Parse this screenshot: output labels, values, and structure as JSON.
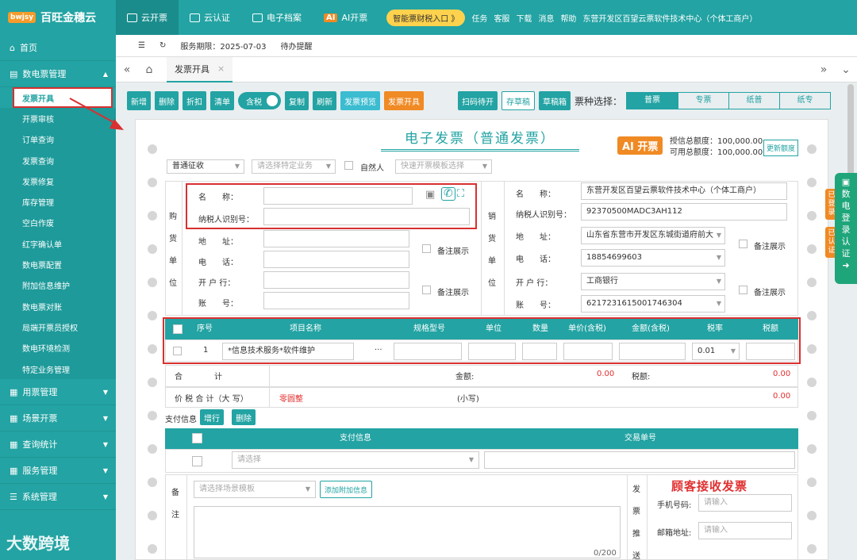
{
  "top": {
    "brand_badge": "bwjsy",
    "brand": "百旺金穗云",
    "tabs": [
      "云开票",
      "云认证",
      "电子档案",
      "AI开票"
    ],
    "ai_badge": "AI",
    "promo": "智能票财税入口 》",
    "right": [
      "任务",
      "客服",
      "下载",
      "消息",
      "帮助",
      "东营开发区百望云票软件技术中心（个体工商户）"
    ]
  },
  "sidebar": {
    "home": "首页",
    "group": "数电票管理",
    "items": [
      "发票开具",
      "开票审核",
      "订单查询",
      "发票查询",
      "发票修复",
      "库存管理",
      "空白作废",
      "红字确认单",
      "数电票配置",
      "附加信息维护",
      "数电票对账",
      "局端开票员授权",
      "数电环境检测",
      "特定业务管理"
    ],
    "groups": [
      "用票管理",
      "场景开票",
      "查询统计",
      "服务管理",
      "系统管理"
    ],
    "watermark": "大数跨境"
  },
  "subbar": {
    "period": "服务期限：2025-07-03",
    "pending": "待办提醒"
  },
  "tab": {
    "label": "发票开具"
  },
  "toolbar": {
    "buttons": [
      "新增",
      "删除",
      "折扣",
      "清单"
    ],
    "tax_incl": "含税",
    "buttons2": [
      "复制",
      "刷新",
      "发票预览",
      "发票开具"
    ],
    "right": [
      "扫码待开",
      "存草稿",
      "草稿箱"
    ],
    "type_label": "票种选择：",
    "types": [
      "普票",
      "专票",
      "纸普",
      "纸专"
    ]
  },
  "invoice": {
    "title": "电子发票（普通发票）",
    "ai_open": "AI 开票",
    "credit_total": "授信总额度：100,000.00",
    "credit_avail": "可用总额度：100,000.00",
    "update_btn": "更新额度",
    "levy": "普通征收",
    "biz_placeholder": "请选择特定业务",
    "natural_person": "自然人",
    "template_placeholder": "快速开票模板选择"
  },
  "buyer": {
    "side": "购货单位",
    "name_lbl": "名　　称：",
    "tax_lbl": "纳税人识别号：",
    "addr_lbl": "地　　址：",
    "phone_lbl": "电　　话：",
    "bank_lbl": "开 户 行：",
    "acct_lbl": "账　　号：",
    "remark1": "备注展示",
    "remark2": "备注展示"
  },
  "seller": {
    "side": "销货单位",
    "name_lbl": "名　　称：",
    "name": "东营开发区百望云票软件技术中心（个体工商户）",
    "tax_lbl": "纳税人识别号：",
    "tax": "92370500MADC3AH112",
    "addr_lbl": "地　　址：",
    "addr": "山东省东营市开发区东城街道府前大",
    "phone_lbl": "电　　话：",
    "phone": "18854699603",
    "bank_lbl": "开 户 行：",
    "bank": "工商银行",
    "acct_lbl": "账　　号：",
    "acct": "6217231615001746304",
    "remark1": "备注展示",
    "remark2": "备注展示"
  },
  "items": {
    "headers": [
      "序号",
      "项目名称",
      "规格型号",
      "单位",
      "数量",
      "单价(含税)",
      "金额(含税)",
      "税率",
      "税额"
    ],
    "row": {
      "no": "1",
      "name": "*信息技术服务*软件维护",
      "more": "···",
      "rate": "0.01"
    }
  },
  "totals": {
    "sum_lbl": "合　　　　计",
    "amount_lbl": "金额:",
    "amount": "0.00",
    "tax_lbl": "税额:",
    "tax": "0.00",
    "cap_lbl": "价 税 合 计（大 写）",
    "cap": "零圆整",
    "small_lbl": "(小写)",
    "small": "0.00"
  },
  "pay": {
    "label": "支付信息",
    "add": "增行",
    "del": "删除",
    "col1": "支付信息",
    "col2": "交易单号",
    "select_ph": "请选择"
  },
  "remark": {
    "side": "备注",
    "scene_ph": "请选择场景模板",
    "add_info": "添加附加信息",
    "count": "0/200",
    "push_side": "发票推送",
    "customer": "顾客接收发票",
    "mobile_lbl": "手机号码:",
    "mobile_ph": "请输入",
    "email_lbl": "邮箱地址:",
    "email_ph": "请输入"
  },
  "float": {
    "text": "数电登录认证",
    "tag1": "已登录",
    "tag2": "已认证"
  }
}
